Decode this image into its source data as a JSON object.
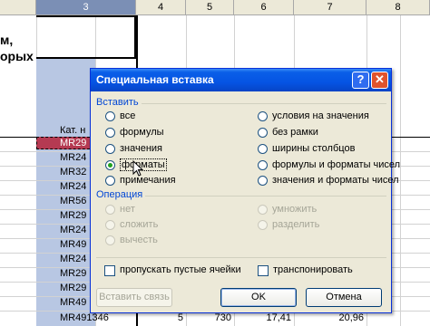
{
  "sheet": {
    "column_headers": [
      "3",
      "4",
      "5",
      "6",
      "7",
      "8"
    ],
    "left_text": [
      "м,",
      "орых"
    ],
    "column_caption": "Кат. н",
    "codes": [
      "MR29",
      "MR24",
      "MR32",
      "MR24",
      "MR56",
      "MR29",
      "MR24",
      "MR49",
      "MR24",
      "MR29",
      "MR29",
      "MR49",
      "MR491346"
    ],
    "bottom_row": {
      "qty": "5",
      "price": "730",
      "v1": "17,41",
      "v2": "20,96"
    }
  },
  "dialog": {
    "title": "Специальная вставка",
    "help_label": "?",
    "close_label": "✕",
    "paste_group_label": "Вставить",
    "paste_left": [
      "все",
      "формулы",
      "значения",
      "форматы",
      "примечания"
    ],
    "paste_right": [
      "условия на значения",
      "без рамки",
      "ширины столбцов",
      "формулы и форматы чисел",
      "значения и форматы чисел"
    ],
    "paste_selected": "форматы",
    "operation_group_label": "Операция",
    "operation_left": [
      "нет",
      "сложить",
      "вычесть"
    ],
    "operation_right": [
      "умножить",
      "разделить"
    ],
    "skip_blanks_label": "пропускать пустые ячейки",
    "transpose_label": "транспонировать",
    "paste_link_label": "Вставить связь",
    "ok_label": "OK",
    "cancel_label": "Отмена"
  },
  "colors": {
    "title_bar": "#0554e3",
    "group_label": "#0046d5",
    "radio_dot": "#21a121",
    "selection_column": "#b8c7e3",
    "copy_marquee_cell": "#b53a52"
  }
}
